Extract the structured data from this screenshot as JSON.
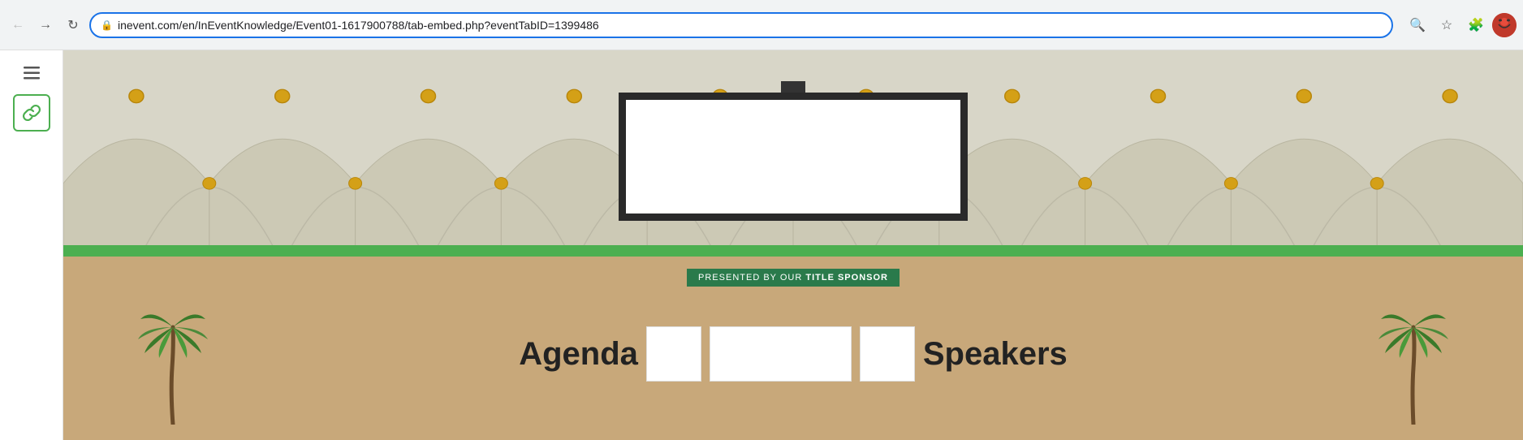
{
  "browser": {
    "back_title": "Back",
    "forward_title": "Forward",
    "reload_title": "Reload",
    "url": "inevent.com/en/InEventKnowledge/Event01-1617900788/tab-embed.php?eventTabID=1399486",
    "search_title": "Search",
    "bookmark_title": "Bookmark",
    "extensions_title": "Extensions",
    "avatar_title": "Profile"
  },
  "sidebar": {
    "menu_label": "Menu",
    "link_label": "Link"
  },
  "scene": {
    "sponsor_text_prefix": "PRESENTED BY OUR ",
    "sponsor_text_bold": "TITLE SPONSOR",
    "agenda_label": "Agenda",
    "speakers_label": "Speakers"
  },
  "icons": {
    "back": "←",
    "forward": "→",
    "reload": "↻",
    "lock": "🔒",
    "search": "🔍",
    "bookmark": "☆",
    "puzzle": "🧩",
    "link": "🔗",
    "hamburger": "≡"
  }
}
